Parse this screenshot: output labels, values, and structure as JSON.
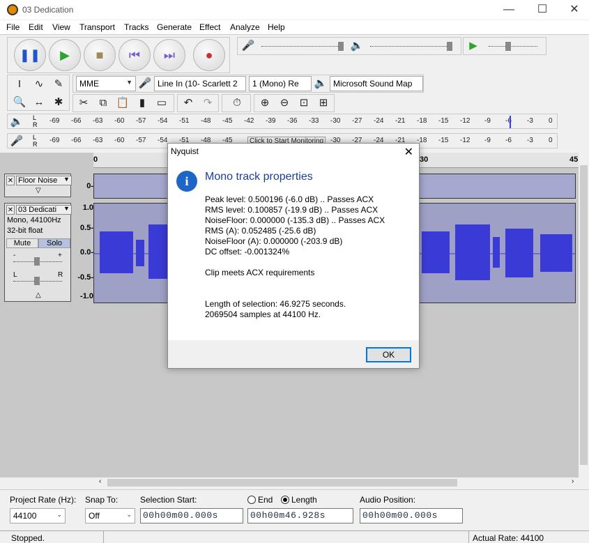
{
  "window": {
    "title": "03 Dedication"
  },
  "menu": [
    "File",
    "Edit",
    "View",
    "Transport",
    "Tracks",
    "Generate",
    "Effect",
    "Analyze",
    "Help"
  ],
  "device": {
    "host": "MME",
    "input": "Line In (10- Scarlett 2",
    "channels": "1 (Mono) Re",
    "output": "Microsoft Sound Map"
  },
  "meters": {
    "ticks": [
      "-69",
      "-66",
      "-63",
      "-60",
      "-57",
      "-54",
      "-51",
      "-48",
      "-45",
      "-42",
      "-39",
      "-36",
      "-33",
      "-30",
      "-27",
      "-24",
      "-21",
      "-18",
      "-15",
      "-12",
      "-9",
      "-6",
      "-3",
      "0"
    ],
    "monitor_hint": "Click to Start Monitoring",
    "L": "L",
    "R": "R"
  },
  "ruler": {
    "labels": [
      "0",
      "30",
      "45"
    ]
  },
  "tracks": [
    {
      "name": "Floor Noise",
      "scale": [
        "0-"
      ]
    },
    {
      "name": "03 Dedicati",
      "info_line1": "Mono, 44100Hz",
      "info_line2": "32-bit float",
      "mute": "Mute",
      "solo": "Solo",
      "scale": [
        "1.0",
        "0.5-",
        "0.0-",
        "-0.5-",
        "-1.0"
      ],
      "gain_minus": "-",
      "gain_plus": "+",
      "pan_left": "L",
      "pan_right": "R"
    }
  ],
  "selection_bar": {
    "project_rate_label": "Project Rate (Hz):",
    "project_rate": "44100",
    "snap_label": "Snap To:",
    "snap": "Off",
    "sel_start_label": "Selection Start:",
    "end_label": "End",
    "length_label": "Length",
    "audio_pos_label": "Audio Position:",
    "sel_start": "00h00m00.000s",
    "length": "00h00m46.928s",
    "audio_pos": "00h00m00.000s"
  },
  "status": {
    "left": "Stopped.",
    "right": "Actual Rate: 44100"
  },
  "dialog": {
    "title": "Nyquist",
    "heading": "Mono track properties",
    "lines": [
      "Peak level: 0.500196 (-6.0 dB)  .. Passes ACX",
      "RMS level: 0.100857 (-19.9 dB)  .. Passes ACX",
      "NoiseFloor: 0.000000 (-135.3 dB)  .. Passes ACX",
      "RMS (A): 0.052485 (-25.6 dB)",
      "NoiseFloor (A): 0.000000 (-203.9 dB)",
      "DC offset: -0.001324%"
    ],
    "verdict": "Clip meets ACX requirements",
    "length_line": "Length of selection: 46.9275 seconds.",
    "samples_line": "2069504 samples at 44100 Hz.",
    "ok_label": "OK"
  }
}
